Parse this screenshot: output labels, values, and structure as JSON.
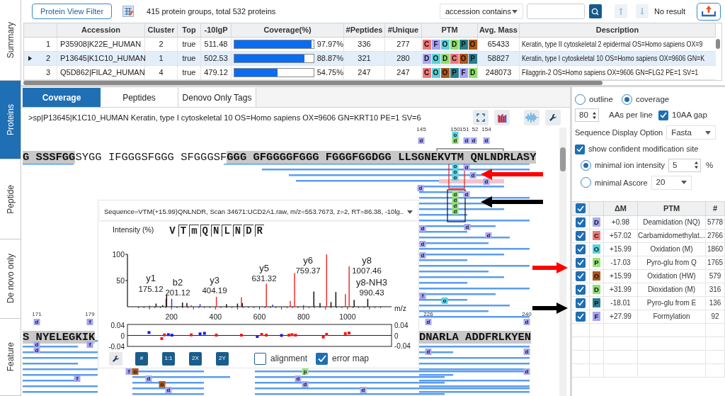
{
  "side_tabs": [
    {
      "label": "Summary",
      "selected": false
    },
    {
      "label": "Proteins",
      "selected": true
    },
    {
      "label": "Peptide",
      "selected": false
    },
    {
      "label": "De novo only",
      "selected": false
    },
    {
      "label": "Feature",
      "selected": false
    }
  ],
  "summary": {
    "filter_button": "Protein View Filter",
    "count_text": "415 protein groups, total 532 proteins",
    "search_mode": "accession contains",
    "search_result": "No result",
    "table": {
      "columns": [
        "Accession",
        "Cluster",
        "Top",
        "-10lgP",
        "Coverage(%)",
        "#Peptides",
        "#Unique",
        "PTM",
        "Avg. Mass",
        "Description"
      ],
      "rows": [
        {
          "index": "1",
          "selected": false,
          "accession": "P35908|K22E_HUMAN",
          "cluster": "2",
          "top": "true",
          "score": "511.48",
          "coverage": "97.97%",
          "level": 0.9797,
          "peptides": "336",
          "unique": "277",
          "ptms": [
            {
              "letter": "C",
              "color": "#f07878"
            },
            {
              "letter": "F",
              "color": "#a3a3f5"
            },
            {
              "letter": "O",
              "color": "#5cd3dc"
            },
            {
              "letter": "D",
              "color": "#8ee06e"
            },
            {
              "letter": "P",
              "color": "#2b7f8e"
            },
            {
              "letter": "O",
              "color": "#b0561a"
            }
          ],
          "mass": "65433",
          "description": "Keratin, type II cytoskeletal 2 epidermal OS=Homo sapiens OX=9"
        },
        {
          "index": "2",
          "selected": true,
          "accession": "P13645|K1C10_HUMAN",
          "cluster": "1",
          "top": "true",
          "score": "502.53",
          "coverage": "88.87%",
          "level": 0.8887,
          "peptides": "321",
          "unique": "280",
          "ptms": [
            {
              "letter": "D",
              "color": "#a9a9f2"
            },
            {
              "letter": "O",
              "color": "#5cd3dc"
            },
            {
              "letter": "D",
              "color": "#8ee06e"
            },
            {
              "letter": "C",
              "color": "#f07878"
            },
            {
              "letter": "O",
              "color": "#b0561a"
            },
            {
              "letter": "P",
              "color": "#2b7f8e"
            }
          ],
          "mass": "58827",
          "description": "Keratin, type I cytoskeletal 10 OS=Homo sapiens OX=9606 GN=K"
        },
        {
          "index": "3",
          "selected": false,
          "accession": "Q5D862|FILA2_HUMAN",
          "cluster": "4",
          "top": "true",
          "score": "479.12",
          "coverage": "54.75%",
          "level": 0.5475,
          "peptides": "247",
          "unique": "247",
          "ptms": [
            {
              "letter": "C",
              "color": "#f07878"
            },
            {
              "letter": "O",
              "color": "#5cd3dc"
            },
            {
              "letter": "O",
              "color": "#b0561a"
            },
            {
              "letter": "P",
              "color": "#2b7f8e"
            },
            {
              "letter": "F",
              "color": "#a3a3f5"
            },
            {
              "letter": "D",
              "color": "#8ee06e"
            }
          ],
          "mass": "248073",
          "description": "Filaggrin-2 OS=Homo sapiens OX=9606 GN=FLG2 PE=1 SV=1"
        }
      ]
    }
  },
  "protein_tabs": [
    {
      "label": "Coverage",
      "selected": true
    },
    {
      "label": "Peptides",
      "selected": false
    },
    {
      "label": "Denovo Only Tags",
      "selected": false
    }
  ],
  "coverage": {
    "header": ">sp|P13645|K1C10_HUMAN Keratin, type I cytoskeletal 10 OS=Homo sapiens OX=9606 GN=KRT10 PE=1 SV=6",
    "lines": [
      {
        "positions": [
          "145",
          "150",
          "151",
          "52",
          "154"
        ],
        "segments": [
          {
            "text": "G SSSFGG",
            "covered": true
          },
          {
            "text": "SYGG IFGGGSFGGG SFGGGSF",
            "covered": false
          },
          {
            "text": "GGG GFGGGGFGGG FGGGFGGDGG LLSGNEKVTM QNLNDRLASY",
            "covered": true
          }
        ]
      },
      {
        "positions": [
          "171",
          "179",
          "226",
          "240"
        ],
        "segments": [
          {
            "text": "S NYELEGKIK",
            "covered": true
          },
          {
            "text": "DNARLA ADDFRLKYEN",
            "covered": true
          }
        ]
      }
    ],
    "mod_tags": [
      {
        "letter": "d",
        "color": "#a9a9f2"
      },
      {
        "letter": "o",
        "color": "#5cd3dc"
      },
      {
        "letter": "d",
        "color": "#8ee06e"
      },
      {
        "letter": "d",
        "color": "#a9a9f2"
      },
      {
        "letter": "d",
        "color": "#a9a9f2"
      },
      {
        "letter": "d",
        "color": "#a9a9f2"
      },
      {
        "letter": "d",
        "color": "#a9a9f2"
      },
      {
        "letter": "o",
        "color": "#5cd3dc"
      },
      {
        "letter": "o",
        "color": "#5cd3dc"
      },
      {
        "letter": "o",
        "color": "#5cd3dc"
      },
      {
        "letter": "d",
        "color": "#a9a9f2"
      },
      {
        "letter": "d",
        "color": "#a9a9f2"
      },
      {
        "letter": "d",
        "color": "#a9a9f2"
      },
      {
        "letter": "d",
        "color": "#8ee06e"
      },
      {
        "letter": "d",
        "color": "#a9a9f2"
      },
      {
        "letter": "d",
        "color": "#8ee06e"
      },
      {
        "letter": "d",
        "color": "#8ee06e"
      },
      {
        "letter": "d",
        "color": "#8ee06e"
      },
      {
        "letter": "d",
        "color": "#a9a9f2"
      },
      {
        "letter": "d",
        "color": "#a9a9f2"
      },
      {
        "letter": "d",
        "color": "#a9a9f2"
      },
      {
        "letter": "d",
        "color": "#a9a9f2"
      },
      {
        "letter": "d",
        "color": "#a9a9f2"
      },
      {
        "letter": "f",
        "color": "#a3a3f5"
      },
      {
        "letter": "o",
        "color": "#5cd3dc"
      },
      {
        "letter": "d",
        "color": "#a9a9f2"
      },
      {
        "letter": "f",
        "color": "#a3a3f5"
      },
      {
        "letter": "d",
        "color": "#a9a9f2"
      },
      {
        "letter": "d",
        "color": "#a9a9f2"
      },
      {
        "letter": "d",
        "color": "#a9a9f2"
      },
      {
        "letter": "d",
        "color": "#a9a9f2"
      },
      {
        "letter": "f",
        "color": "#a3a3f5"
      },
      {
        "letter": "d",
        "color": "#a9a9f2"
      },
      {
        "letter": "d",
        "color": "#a9a9f2"
      },
      {
        "letter": "f",
        "color": "#a3a3f5"
      },
      {
        "letter": "o",
        "color": "#b0561a"
      },
      {
        "letter": "d",
        "color": "#a9a9f2"
      },
      {
        "letter": "o",
        "color": "#b0561a"
      },
      {
        "letter": "d",
        "color": "#a9a9f2"
      },
      {
        "letter": "p",
        "color": "#9be37a"
      },
      {
        "letter": "d",
        "color": "#a9a9f2"
      },
      {
        "letter": "d",
        "color": "#a9a9f2"
      },
      {
        "letter": "d",
        "color": "#a9a9f2"
      },
      {
        "letter": "f",
        "color": "#a3a3f5"
      },
      {
        "letter": "d",
        "color": "#a9a9f2"
      }
    ]
  },
  "spectrum": {
    "selection": "Sequence=VTM(+15.99)QNLNDR, Scan 34671:UCD2A1.raw, m/z=553.7673, z=2, RT=86.38, -10lg..",
    "residues": [
      "V",
      "T",
      "m",
      "Q",
      "N",
      "L",
      "N",
      "D",
      "R"
    ],
    "chart_data": {
      "type": "bar",
      "ylabel": "Intensity (%)",
      "xlabel": "m/z",
      "series": [
        {
          "color": "#f03030",
          "x": [
            175.12,
            290,
            404.19,
            518,
            631.32,
            740,
            759.37,
            905,
            990.43,
            1007.46
          ],
          "values": [
            15,
            3,
            19,
            18,
            44,
            11,
            64,
            100,
            24,
            77
          ]
        },
        {
          "color": "#2a3cf0",
          "x": [
            100,
            201.12,
            330,
            660,
            800
          ],
          "values": [
            2,
            15,
            5,
            4,
            3
          ]
        },
        {
          "color": "#111111",
          "x": [
            130,
            160,
            178,
            250,
            270,
            450,
            500,
            522,
            847,
            875,
            925,
            947,
            1030,
            1092
          ],
          "values": [
            6,
            3,
            23,
            8,
            7,
            5,
            6,
            7,
            29,
            7,
            9,
            28,
            13,
            15
          ]
        }
      ],
      "xlim": [
        0,
        1200
      ],
      "ylim": [
        0,
        100
      ],
      "xticks": [
        200,
        400,
        600,
        800,
        1000
      ],
      "yticks": [
        50,
        100
      ],
      "annotations": [
        "y1",
        "175.12",
        "b2",
        "201.12",
        "y3",
        "404.19",
        "y5",
        "631.32",
        "y6",
        "759.37",
        "y8",
        "1007.46",
        "y8-NH3",
        "990.43"
      ]
    },
    "error_map": {
      "chart_data": {
        "type": "scatter",
        "series": [
          {
            "color": "#1a1af0",
            "x": [
              98,
              186,
              202,
              330,
              350,
              590,
              700
            ],
            "values": [
              0.011,
              0.003,
              0.001,
              0.006,
              0.008,
              -0.004,
              0.0
            ]
          },
          {
            "color": "#f01a1a",
            "x": [
              156,
              168,
              290,
              404,
              518,
              610,
              631,
              734,
              748,
              764,
              890,
              905,
              990,
              1007
            ],
            "values": [
              -0.012,
              0.002,
              0.002,
              0.001,
              0.001,
              0.004,
              0.001,
              0.001,
              0.003,
              0.001,
              -0.006,
              0.004,
              0.007,
              0.009
            ]
          }
        ],
        "xlim": [
          0,
          1200
        ],
        "ylim": [
          -0.04,
          0.04
        ],
        "yticks": [
          {
            "value": 0.04,
            "label": "0.04"
          },
          {
            "value": 0,
            "label": "0"
          },
          {
            "value": -0.04,
            "label": "-0.04"
          }
        ]
      },
      "right_labels": [
        "0.04",
        "0",
        "-0.04"
      ]
    },
    "tool_buttons": [
      "#",
      "1:1",
      "2X",
      "2Y"
    ],
    "options": [
      {
        "label": "alignment",
        "checked": false
      },
      {
        "label": "error map",
        "checked": true
      }
    ]
  },
  "display_options": {
    "modes": [
      {
        "label": "outline",
        "selected": false
      },
      {
        "label": "coverage",
        "selected": true
      }
    ],
    "aas_per_line": "80",
    "aas_label": "AAs per line",
    "gap": {
      "label": "10AA gap",
      "checked": true
    },
    "display_option_label": "Sequence Display Option",
    "display_option": "Fasta",
    "confident": {
      "label": "show confident modification site",
      "checked": true
    },
    "filters": [
      {
        "label": "minimal ion intensity",
        "selected": true,
        "value": "5",
        "unit": "%",
        "kind": "spin"
      },
      {
        "label": "minimal Ascore",
        "selected": false,
        "value": "20",
        "kind": "select"
      }
    ]
  },
  "ptm_table": {
    "all_checked": true,
    "columns": [
      "ΔM",
      "PTM",
      "#"
    ],
    "rows": [
      {
        "checked": true,
        "letter": "D",
        "color": "#a9a9f2",
        "delta": "+0.98",
        "name": "Deamidation (NQ)",
        "count": "5778"
      },
      {
        "checked": true,
        "letter": "C",
        "color": "#f07878",
        "delta": "+57.02",
        "name": "Carbamidomethylat...",
        "count": "2766"
      },
      {
        "checked": true,
        "letter": "O",
        "color": "#5cd3dc",
        "delta": "+15.99",
        "name": "Oxidation (M)",
        "count": "1860"
      },
      {
        "checked": true,
        "letter": "P",
        "color": "#9be37a",
        "delta": "-17.03",
        "name": "Pyro-glu from Q",
        "count": "1765"
      },
      {
        "checked": true,
        "letter": "O",
        "color": "#b0561a",
        "delta": "+15.99",
        "name": "Oxidation (HW)",
        "count": "579"
      },
      {
        "checked": true,
        "letter": "D",
        "color": "#8ee06e",
        "delta": "+31.99",
        "name": "Dioxidation (M)",
        "count": "316"
      },
      {
        "checked": true,
        "letter": "P",
        "color": "#2b7f8e",
        "delta": "-18.01",
        "name": "Pyro-glu from E",
        "count": "136"
      },
      {
        "checked": true,
        "letter": "F",
        "color": "#a3a3f5",
        "delta": "+27.99",
        "name": "Formylation",
        "count": "92"
      }
    ]
  },
  "annotation_arrows": [
    {
      "color": "#ff0000"
    },
    {
      "color": "#000000"
    },
    {
      "color": "#ff0000"
    },
    {
      "color": "#000000"
    }
  ]
}
